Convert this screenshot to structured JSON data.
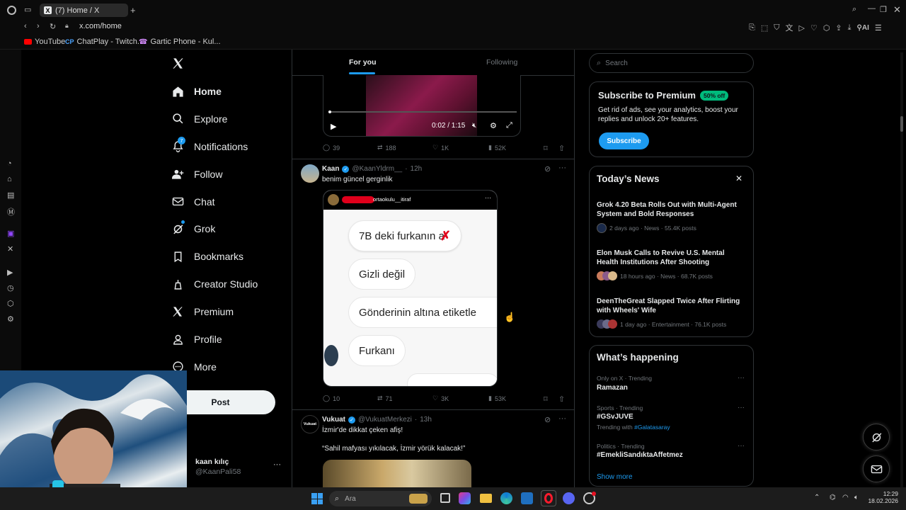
{
  "browser": {
    "tab_title": "(7) Home / X",
    "url": "x.com/home",
    "bookmarks": [
      {
        "label": "YouTube",
        "icon": "youtube-icon"
      },
      {
        "label": "ChatPlay - Twitch...",
        "icon": "chatplay-icon"
      },
      {
        "label": "Gartic Phone - Kul...",
        "icon": "gartic-icon"
      }
    ],
    "ai_label": "AI"
  },
  "nav": {
    "items": [
      {
        "label": "Home",
        "icon": "home-icon",
        "active": true
      },
      {
        "label": "Explore",
        "icon": "search-icon"
      },
      {
        "label": "Notifications",
        "icon": "bell-icon",
        "badge": "7"
      },
      {
        "label": "Follow",
        "icon": "add-person-icon"
      },
      {
        "label": "Chat",
        "icon": "mail-icon"
      },
      {
        "label": "Grok",
        "icon": "grok-icon"
      },
      {
        "label": "Bookmarks",
        "icon": "bookmark-icon"
      },
      {
        "label": "Creator Studio",
        "icon": "creator-icon"
      },
      {
        "label": "Premium",
        "icon": "x-icon"
      },
      {
        "label": "Profile",
        "icon": "person-icon"
      },
      {
        "label": "More",
        "icon": "more-icon"
      }
    ],
    "post_label": "Post",
    "account": {
      "name": "kaan kılıç",
      "handle": "@KaanPali58"
    }
  },
  "feed": {
    "tabs": [
      "For you",
      "Following"
    ],
    "video_time": "0:02 / 1:15",
    "post1_stats": {
      "replies": "39",
      "reposts": "188",
      "likes": "1K",
      "views": "52K"
    },
    "post2": {
      "name": "Kaan",
      "handle": "@KaanYldrm__",
      "time": "12h",
      "text": "benim güncel gerginlik",
      "img_account": "ortaokulu__itiraf",
      "bubbles": [
        "7B deki furkanın a",
        "Gizli değil",
        "Gönderinin altına etiketle",
        "Furkanı"
      ],
      "stats": {
        "replies": "10",
        "reposts": "71",
        "likes": "3K",
        "views": "53K"
      }
    },
    "post3": {
      "name": "Vukuat",
      "handle": "@VukuatMerkezi",
      "time": "13h",
      "avatar_text": "Vukuat",
      "text1": "İzmir'de dikkat çeken afiş!",
      "text2": "“Sahil mafyası yıkılacak, İzmir yörük kalacak!”"
    }
  },
  "right": {
    "search_placeholder": "Search",
    "premium": {
      "title": "Subscribe to Premium",
      "badge": "50% off",
      "desc": "Get rid of ads, see your analytics, boost your replies and unlock 20+ features.",
      "button": "Subscribe"
    },
    "news": {
      "title": "Today’s News",
      "items": [
        {
          "title": "Grok 4.20 Beta Rolls Out with Multi-Agent System and Bold Responses",
          "meta": "2 days ago · News · 55.4K posts"
        },
        {
          "title": "Elon Musk Calls to Revive U.S. Mental Health Institutions After Shooting",
          "meta": "18 hours ago · News · 68.7K posts"
        },
        {
          "title": "DeenTheGreat Slapped Twice After Flirting with Wheels' Wife",
          "meta": "1 day ago · Entertainment · 76.1K posts"
        }
      ]
    },
    "happening": {
      "title": "What’s happening",
      "items": [
        {
          "context": "Only on X · Trending",
          "tag": "Ramazan"
        },
        {
          "context": "Sports · Trending",
          "tag": "#GSvJUVE",
          "with_label": "Trending with",
          "with_tag": "#Galatasaray"
        },
        {
          "context": "Politics · Trending",
          "tag": "#EmekliSandıktaAffetmez"
        }
      ],
      "show_more": "Show more"
    }
  },
  "taskbar": {
    "search_placeholder": "Ara",
    "time": "12:29",
    "date": "18.02.2026"
  },
  "colors": {
    "accent": "#1d9bf0",
    "premium_badge": "#00ba7c",
    "background": "#000000",
    "border": "#2f3336"
  }
}
